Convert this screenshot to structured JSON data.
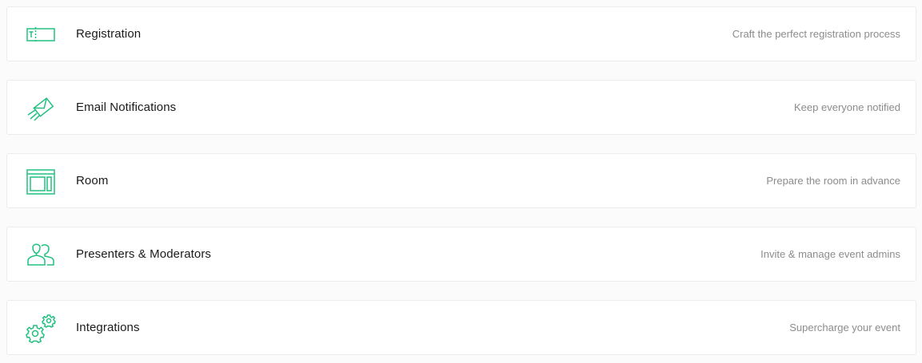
{
  "accent_color": "#21c080",
  "items": [
    {
      "icon": "ticket-icon",
      "title": "Registration",
      "description": "Craft the perfect registration process"
    },
    {
      "icon": "send-envelope-icon",
      "title": "Email Notifications",
      "description": "Keep everyone notified"
    },
    {
      "icon": "room-layout-icon",
      "title": "Room",
      "description": "Prepare the room in advance"
    },
    {
      "icon": "users-icon",
      "title": "Presenters & Moderators",
      "description": "Invite & manage event admins"
    },
    {
      "icon": "gears-icon",
      "title": "Integrations",
      "description": "Supercharge your event"
    }
  ]
}
